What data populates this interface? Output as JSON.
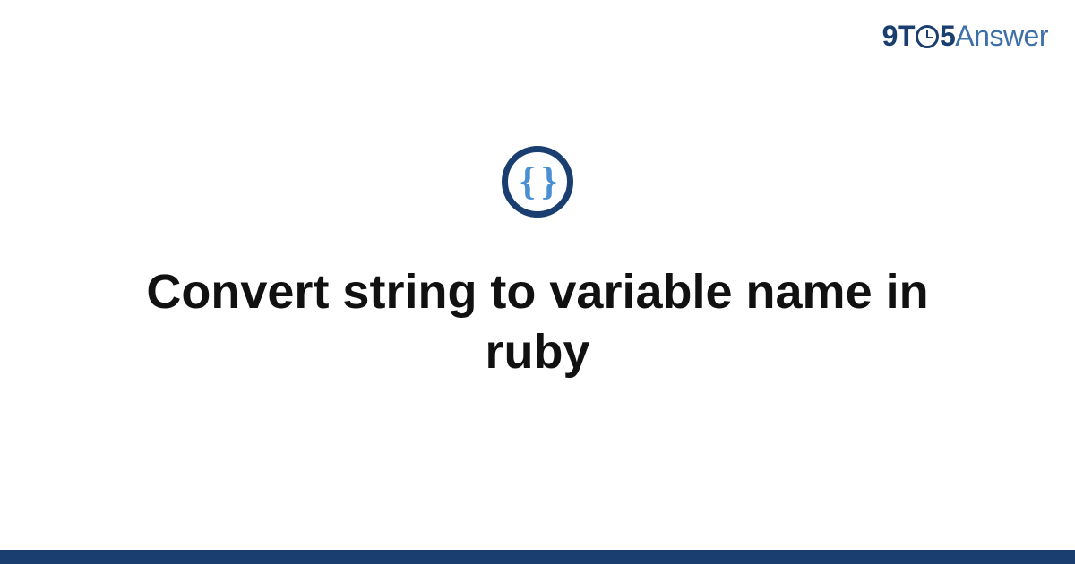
{
  "brand": {
    "part1": "9",
    "part2": "T",
    "part3": "5",
    "part4": "Answer"
  },
  "icon": {
    "glyph": "{ }"
  },
  "title": "Convert string to variable name in ruby"
}
